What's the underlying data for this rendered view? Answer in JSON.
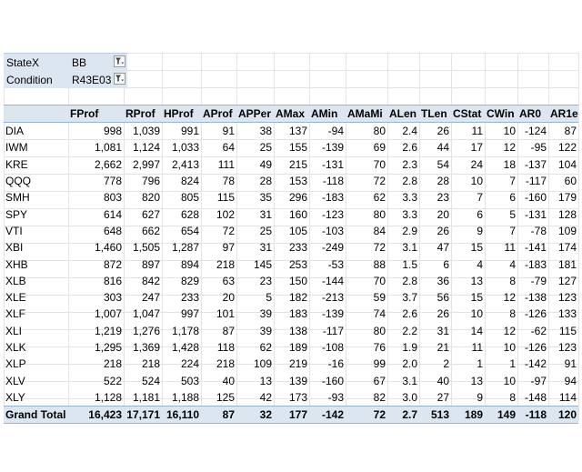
{
  "filters": [
    {
      "label": "StateX",
      "value": "BB"
    },
    {
      "label": "Condition",
      "value": "R43E03"
    }
  ],
  "table": {
    "columns": [
      "",
      "FProf",
      "RProf",
      "HProf",
      "AProf",
      "APPer",
      "AMax",
      "AMin",
      "AMaMi",
      "ALen",
      "TLen",
      "CStat",
      "CWin",
      "AR0",
      "AR1e"
    ],
    "rows": [
      [
        "DIA",
        "998",
        "1,039",
        "991",
        "91",
        "38",
        "137",
        "-94",
        "80",
        "2.4",
        "26",
        "11",
        "10",
        "-124",
        "87"
      ],
      [
        "IWM",
        "1,081",
        "1,124",
        "1,033",
        "64",
        "25",
        "155",
        "-139",
        "69",
        "2.6",
        "44",
        "17",
        "12",
        "-95",
        "122"
      ],
      [
        "KRE",
        "2,662",
        "2,997",
        "2,413",
        "111",
        "49",
        "215",
        "-131",
        "70",
        "2.3",
        "54",
        "24",
        "18",
        "-137",
        "104"
      ],
      [
        "QQQ",
        "778",
        "796",
        "824",
        "78",
        "28",
        "153",
        "-118",
        "72",
        "2.8",
        "28",
        "10",
        "7",
        "-117",
        "60"
      ],
      [
        "SMH",
        "803",
        "820",
        "805",
        "115",
        "35",
        "296",
        "-183",
        "62",
        "3.3",
        "23",
        "7",
        "6",
        "-160",
        "179"
      ],
      [
        "SPY",
        "614",
        "627",
        "628",
        "102",
        "31",
        "160",
        "-123",
        "80",
        "3.3",
        "20",
        "6",
        "5",
        "-131",
        "128"
      ],
      [
        "VTI",
        "648",
        "662",
        "654",
        "72",
        "25",
        "105",
        "-103",
        "84",
        "2.9",
        "26",
        "9",
        "7",
        "-78",
        "109"
      ],
      [
        "XBI",
        "1,460",
        "1,505",
        "1,287",
        "97",
        "31",
        "233",
        "-249",
        "72",
        "3.1",
        "47",
        "15",
        "11",
        "-141",
        "174"
      ],
      [
        "XHB",
        "872",
        "897",
        "894",
        "218",
        "145",
        "253",
        "-53",
        "88",
        "1.5",
        "6",
        "4",
        "4",
        "-183",
        "181"
      ],
      [
        "XLB",
        "816",
        "842",
        "829",
        "63",
        "23",
        "150",
        "-144",
        "70",
        "2.8",
        "36",
        "13",
        "8",
        "-79",
        "127"
      ],
      [
        "XLE",
        "303",
        "247",
        "233",
        "20",
        "5",
        "182",
        "-213",
        "59",
        "3.7",
        "56",
        "15",
        "12",
        "-138",
        "123"
      ],
      [
        "XLF",
        "1,007",
        "1,047",
        "997",
        "101",
        "39",
        "183",
        "-139",
        "74",
        "2.6",
        "26",
        "10",
        "8",
        "-126",
        "133"
      ],
      [
        "XLI",
        "1,219",
        "1,276",
        "1,178",
        "87",
        "39",
        "138",
        "-117",
        "80",
        "2.2",
        "31",
        "14",
        "12",
        "-62",
        "115"
      ],
      [
        "XLK",
        "1,295",
        "1,369",
        "1,428",
        "118",
        "62",
        "189",
        "-108",
        "76",
        "1.9",
        "21",
        "11",
        "10",
        "-126",
        "123"
      ],
      [
        "XLP",
        "218",
        "218",
        "224",
        "218",
        "109",
        "219",
        "-16",
        "99",
        "2.0",
        "2",
        "1",
        "1",
        "-142",
        "91"
      ],
      [
        "XLV",
        "522",
        "524",
        "503",
        "40",
        "13",
        "139",
        "-160",
        "67",
        "3.1",
        "40",
        "13",
        "10",
        "-97",
        "94"
      ],
      [
        "XLY",
        "1,128",
        "1,181",
        "1,188",
        "125",
        "42",
        "173",
        "-93",
        "82",
        "3.0",
        "27",
        "9",
        "8",
        "-148",
        "114"
      ]
    ],
    "total": [
      "Grand Total",
      "16,423",
      "17,171",
      "16,110",
      "87",
      "32",
      "177",
      "-142",
      "72",
      "2.7",
      "513",
      "189",
      "149",
      "-118",
      "120"
    ]
  }
}
